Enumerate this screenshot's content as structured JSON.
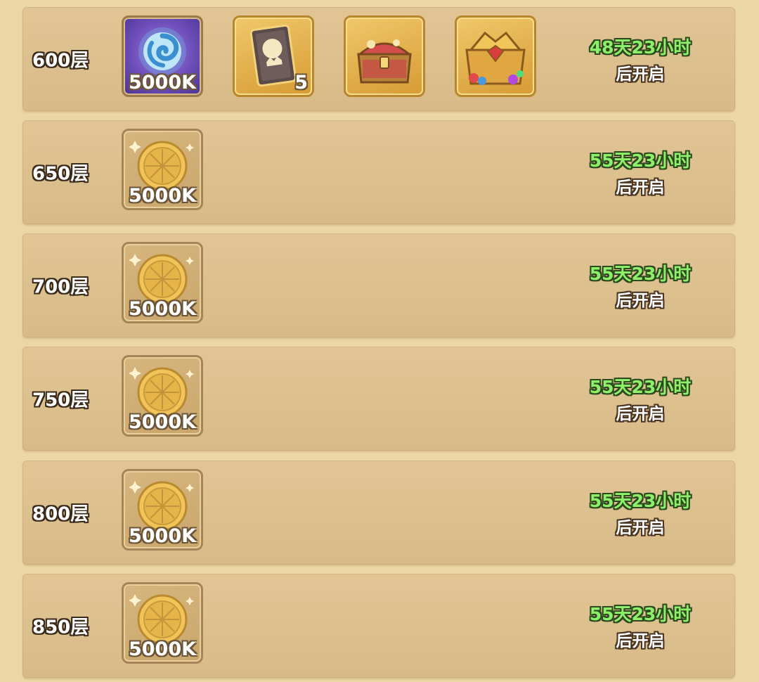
{
  "rows": [
    {
      "floor": "600层",
      "timer": "48天23小时",
      "timer_label": "后开启",
      "items": [
        {
          "icon": "swirl-orb-icon",
          "qty": "5000K"
        },
        {
          "icon": "card-icon",
          "qty": "5"
        },
        {
          "icon": "red-chest-icon",
          "qty": ""
        },
        {
          "icon": "gem-chest-icon",
          "qty": ""
        }
      ]
    },
    {
      "floor": "650层",
      "timer": "55天23小时",
      "timer_label": "后开启",
      "items": [
        {
          "icon": "gold-coin-icon",
          "qty": "5000K"
        }
      ]
    },
    {
      "floor": "700层",
      "timer": "55天23小时",
      "timer_label": "后开启",
      "items": [
        {
          "icon": "gold-coin-icon",
          "qty": "5000K"
        }
      ]
    },
    {
      "floor": "750层",
      "timer": "55天23小时",
      "timer_label": "后开启",
      "items": [
        {
          "icon": "gold-coin-icon",
          "qty": "5000K"
        }
      ]
    },
    {
      "floor": "800层",
      "timer": "55天23小时",
      "timer_label": "后开启",
      "items": [
        {
          "icon": "gold-coin-icon",
          "qty": "5000K"
        }
      ]
    },
    {
      "floor": "850层",
      "timer": "55天23小时",
      "timer_label": "后开启",
      "items": [
        {
          "icon": "gold-coin-icon",
          "qty": "5000K"
        }
      ]
    }
  ],
  "colors": {
    "background": "#ecd6a6",
    "row": "#dcc08e",
    "timer_green": "#8ef06a"
  }
}
